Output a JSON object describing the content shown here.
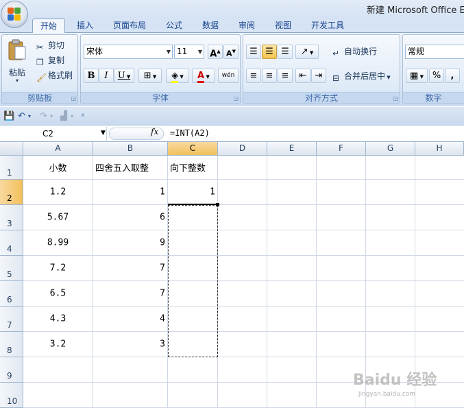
{
  "window": {
    "title": "新建 Microsoft Office Exc"
  },
  "tabs": [
    {
      "label": "开始",
      "active": true
    },
    {
      "label": "插入"
    },
    {
      "label": "页面布局"
    },
    {
      "label": "公式"
    },
    {
      "label": "数据"
    },
    {
      "label": "审阅"
    },
    {
      "label": "视图"
    },
    {
      "label": "开发工具"
    }
  ],
  "clipboard": {
    "paste_label": "粘贴",
    "cut_label": "剪切",
    "copy_label": "复制",
    "format_painter_label": "格式刷",
    "group_label": "剪贴板"
  },
  "font": {
    "name": "宋体",
    "size": "11",
    "grow": "A",
    "shrink": "A",
    "bold": "B",
    "italic": "I",
    "underline": "U",
    "font_color": "A",
    "phonetic": "wén",
    "group_label": "字体"
  },
  "alignment": {
    "wrap_text_label": "自动换行",
    "merge_center_label": "合并后居中",
    "group_label": "对齐方式"
  },
  "number": {
    "format": "常规",
    "percent": "%",
    "comma": ",",
    "group_label": "数字"
  },
  "formula_bar": {
    "name_box": "C2",
    "fx": "fx",
    "formula": "=INT(A2)"
  },
  "sheet": {
    "columns": [
      "A",
      "B",
      "C",
      "D",
      "E",
      "F",
      "G",
      "H"
    ],
    "selected_column": "C",
    "rows": [
      "1",
      "2",
      "3",
      "4",
      "5",
      "6",
      "7",
      "8",
      "9",
      "10"
    ],
    "selected_row": "2",
    "header_row": {
      "a": "小数",
      "b": "四舍五入取整",
      "c": "向下整数"
    },
    "data": [
      {
        "a": "1.2",
        "b": "1",
        "c": "1"
      },
      {
        "a": "5.67",
        "b": "6",
        "c": ""
      },
      {
        "a": "8.99",
        "b": "9",
        "c": ""
      },
      {
        "a": "7.2",
        "b": "7",
        "c": ""
      },
      {
        "a": "6.5",
        "b": "7",
        "c": ""
      },
      {
        "a": "4.3",
        "b": "4",
        "c": ""
      },
      {
        "a": "3.2",
        "b": "3",
        "c": ""
      }
    ]
  },
  "watermark": {
    "main": "Baidu 经验",
    "sub": "jingyan.baidu.com"
  }
}
